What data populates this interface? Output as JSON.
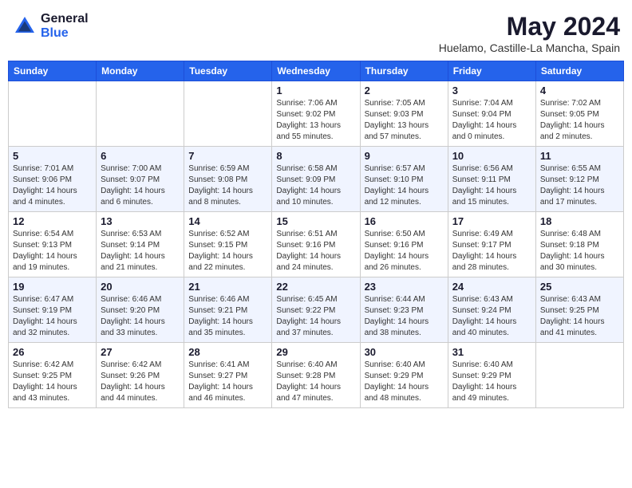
{
  "header": {
    "logo_general": "General",
    "logo_blue": "Blue",
    "month_year": "May 2024",
    "location": "Huelamo, Castille-La Mancha, Spain"
  },
  "days_of_week": [
    "Sunday",
    "Monday",
    "Tuesday",
    "Wednesday",
    "Thursday",
    "Friday",
    "Saturday"
  ],
  "weeks": [
    [
      {
        "day": "",
        "info": ""
      },
      {
        "day": "",
        "info": ""
      },
      {
        "day": "",
        "info": ""
      },
      {
        "day": "1",
        "info": "Sunrise: 7:06 AM\nSunset: 9:02 PM\nDaylight: 13 hours\nand 55 minutes."
      },
      {
        "day": "2",
        "info": "Sunrise: 7:05 AM\nSunset: 9:03 PM\nDaylight: 13 hours\nand 57 minutes."
      },
      {
        "day": "3",
        "info": "Sunrise: 7:04 AM\nSunset: 9:04 PM\nDaylight: 14 hours\nand 0 minutes."
      },
      {
        "day": "4",
        "info": "Sunrise: 7:02 AM\nSunset: 9:05 PM\nDaylight: 14 hours\nand 2 minutes."
      }
    ],
    [
      {
        "day": "5",
        "info": "Sunrise: 7:01 AM\nSunset: 9:06 PM\nDaylight: 14 hours\nand 4 minutes."
      },
      {
        "day": "6",
        "info": "Sunrise: 7:00 AM\nSunset: 9:07 PM\nDaylight: 14 hours\nand 6 minutes."
      },
      {
        "day": "7",
        "info": "Sunrise: 6:59 AM\nSunset: 9:08 PM\nDaylight: 14 hours\nand 8 minutes."
      },
      {
        "day": "8",
        "info": "Sunrise: 6:58 AM\nSunset: 9:09 PM\nDaylight: 14 hours\nand 10 minutes."
      },
      {
        "day": "9",
        "info": "Sunrise: 6:57 AM\nSunset: 9:10 PM\nDaylight: 14 hours\nand 12 minutes."
      },
      {
        "day": "10",
        "info": "Sunrise: 6:56 AM\nSunset: 9:11 PM\nDaylight: 14 hours\nand 15 minutes."
      },
      {
        "day": "11",
        "info": "Sunrise: 6:55 AM\nSunset: 9:12 PM\nDaylight: 14 hours\nand 17 minutes."
      }
    ],
    [
      {
        "day": "12",
        "info": "Sunrise: 6:54 AM\nSunset: 9:13 PM\nDaylight: 14 hours\nand 19 minutes."
      },
      {
        "day": "13",
        "info": "Sunrise: 6:53 AM\nSunset: 9:14 PM\nDaylight: 14 hours\nand 21 minutes."
      },
      {
        "day": "14",
        "info": "Sunrise: 6:52 AM\nSunset: 9:15 PM\nDaylight: 14 hours\nand 22 minutes."
      },
      {
        "day": "15",
        "info": "Sunrise: 6:51 AM\nSunset: 9:16 PM\nDaylight: 14 hours\nand 24 minutes."
      },
      {
        "day": "16",
        "info": "Sunrise: 6:50 AM\nSunset: 9:16 PM\nDaylight: 14 hours\nand 26 minutes."
      },
      {
        "day": "17",
        "info": "Sunrise: 6:49 AM\nSunset: 9:17 PM\nDaylight: 14 hours\nand 28 minutes."
      },
      {
        "day": "18",
        "info": "Sunrise: 6:48 AM\nSunset: 9:18 PM\nDaylight: 14 hours\nand 30 minutes."
      }
    ],
    [
      {
        "day": "19",
        "info": "Sunrise: 6:47 AM\nSunset: 9:19 PM\nDaylight: 14 hours\nand 32 minutes."
      },
      {
        "day": "20",
        "info": "Sunrise: 6:46 AM\nSunset: 9:20 PM\nDaylight: 14 hours\nand 33 minutes."
      },
      {
        "day": "21",
        "info": "Sunrise: 6:46 AM\nSunset: 9:21 PM\nDaylight: 14 hours\nand 35 minutes."
      },
      {
        "day": "22",
        "info": "Sunrise: 6:45 AM\nSunset: 9:22 PM\nDaylight: 14 hours\nand 37 minutes."
      },
      {
        "day": "23",
        "info": "Sunrise: 6:44 AM\nSunset: 9:23 PM\nDaylight: 14 hours\nand 38 minutes."
      },
      {
        "day": "24",
        "info": "Sunrise: 6:43 AM\nSunset: 9:24 PM\nDaylight: 14 hours\nand 40 minutes."
      },
      {
        "day": "25",
        "info": "Sunrise: 6:43 AM\nSunset: 9:25 PM\nDaylight: 14 hours\nand 41 minutes."
      }
    ],
    [
      {
        "day": "26",
        "info": "Sunrise: 6:42 AM\nSunset: 9:25 PM\nDaylight: 14 hours\nand 43 minutes."
      },
      {
        "day": "27",
        "info": "Sunrise: 6:42 AM\nSunset: 9:26 PM\nDaylight: 14 hours\nand 44 minutes."
      },
      {
        "day": "28",
        "info": "Sunrise: 6:41 AM\nSunset: 9:27 PM\nDaylight: 14 hours\nand 46 minutes."
      },
      {
        "day": "29",
        "info": "Sunrise: 6:40 AM\nSunset: 9:28 PM\nDaylight: 14 hours\nand 47 minutes."
      },
      {
        "day": "30",
        "info": "Sunrise: 6:40 AM\nSunset: 9:29 PM\nDaylight: 14 hours\nand 48 minutes."
      },
      {
        "day": "31",
        "info": "Sunrise: 6:40 AM\nSunset: 9:29 PM\nDaylight: 14 hours\nand 49 minutes."
      },
      {
        "day": "",
        "info": ""
      }
    ]
  ]
}
